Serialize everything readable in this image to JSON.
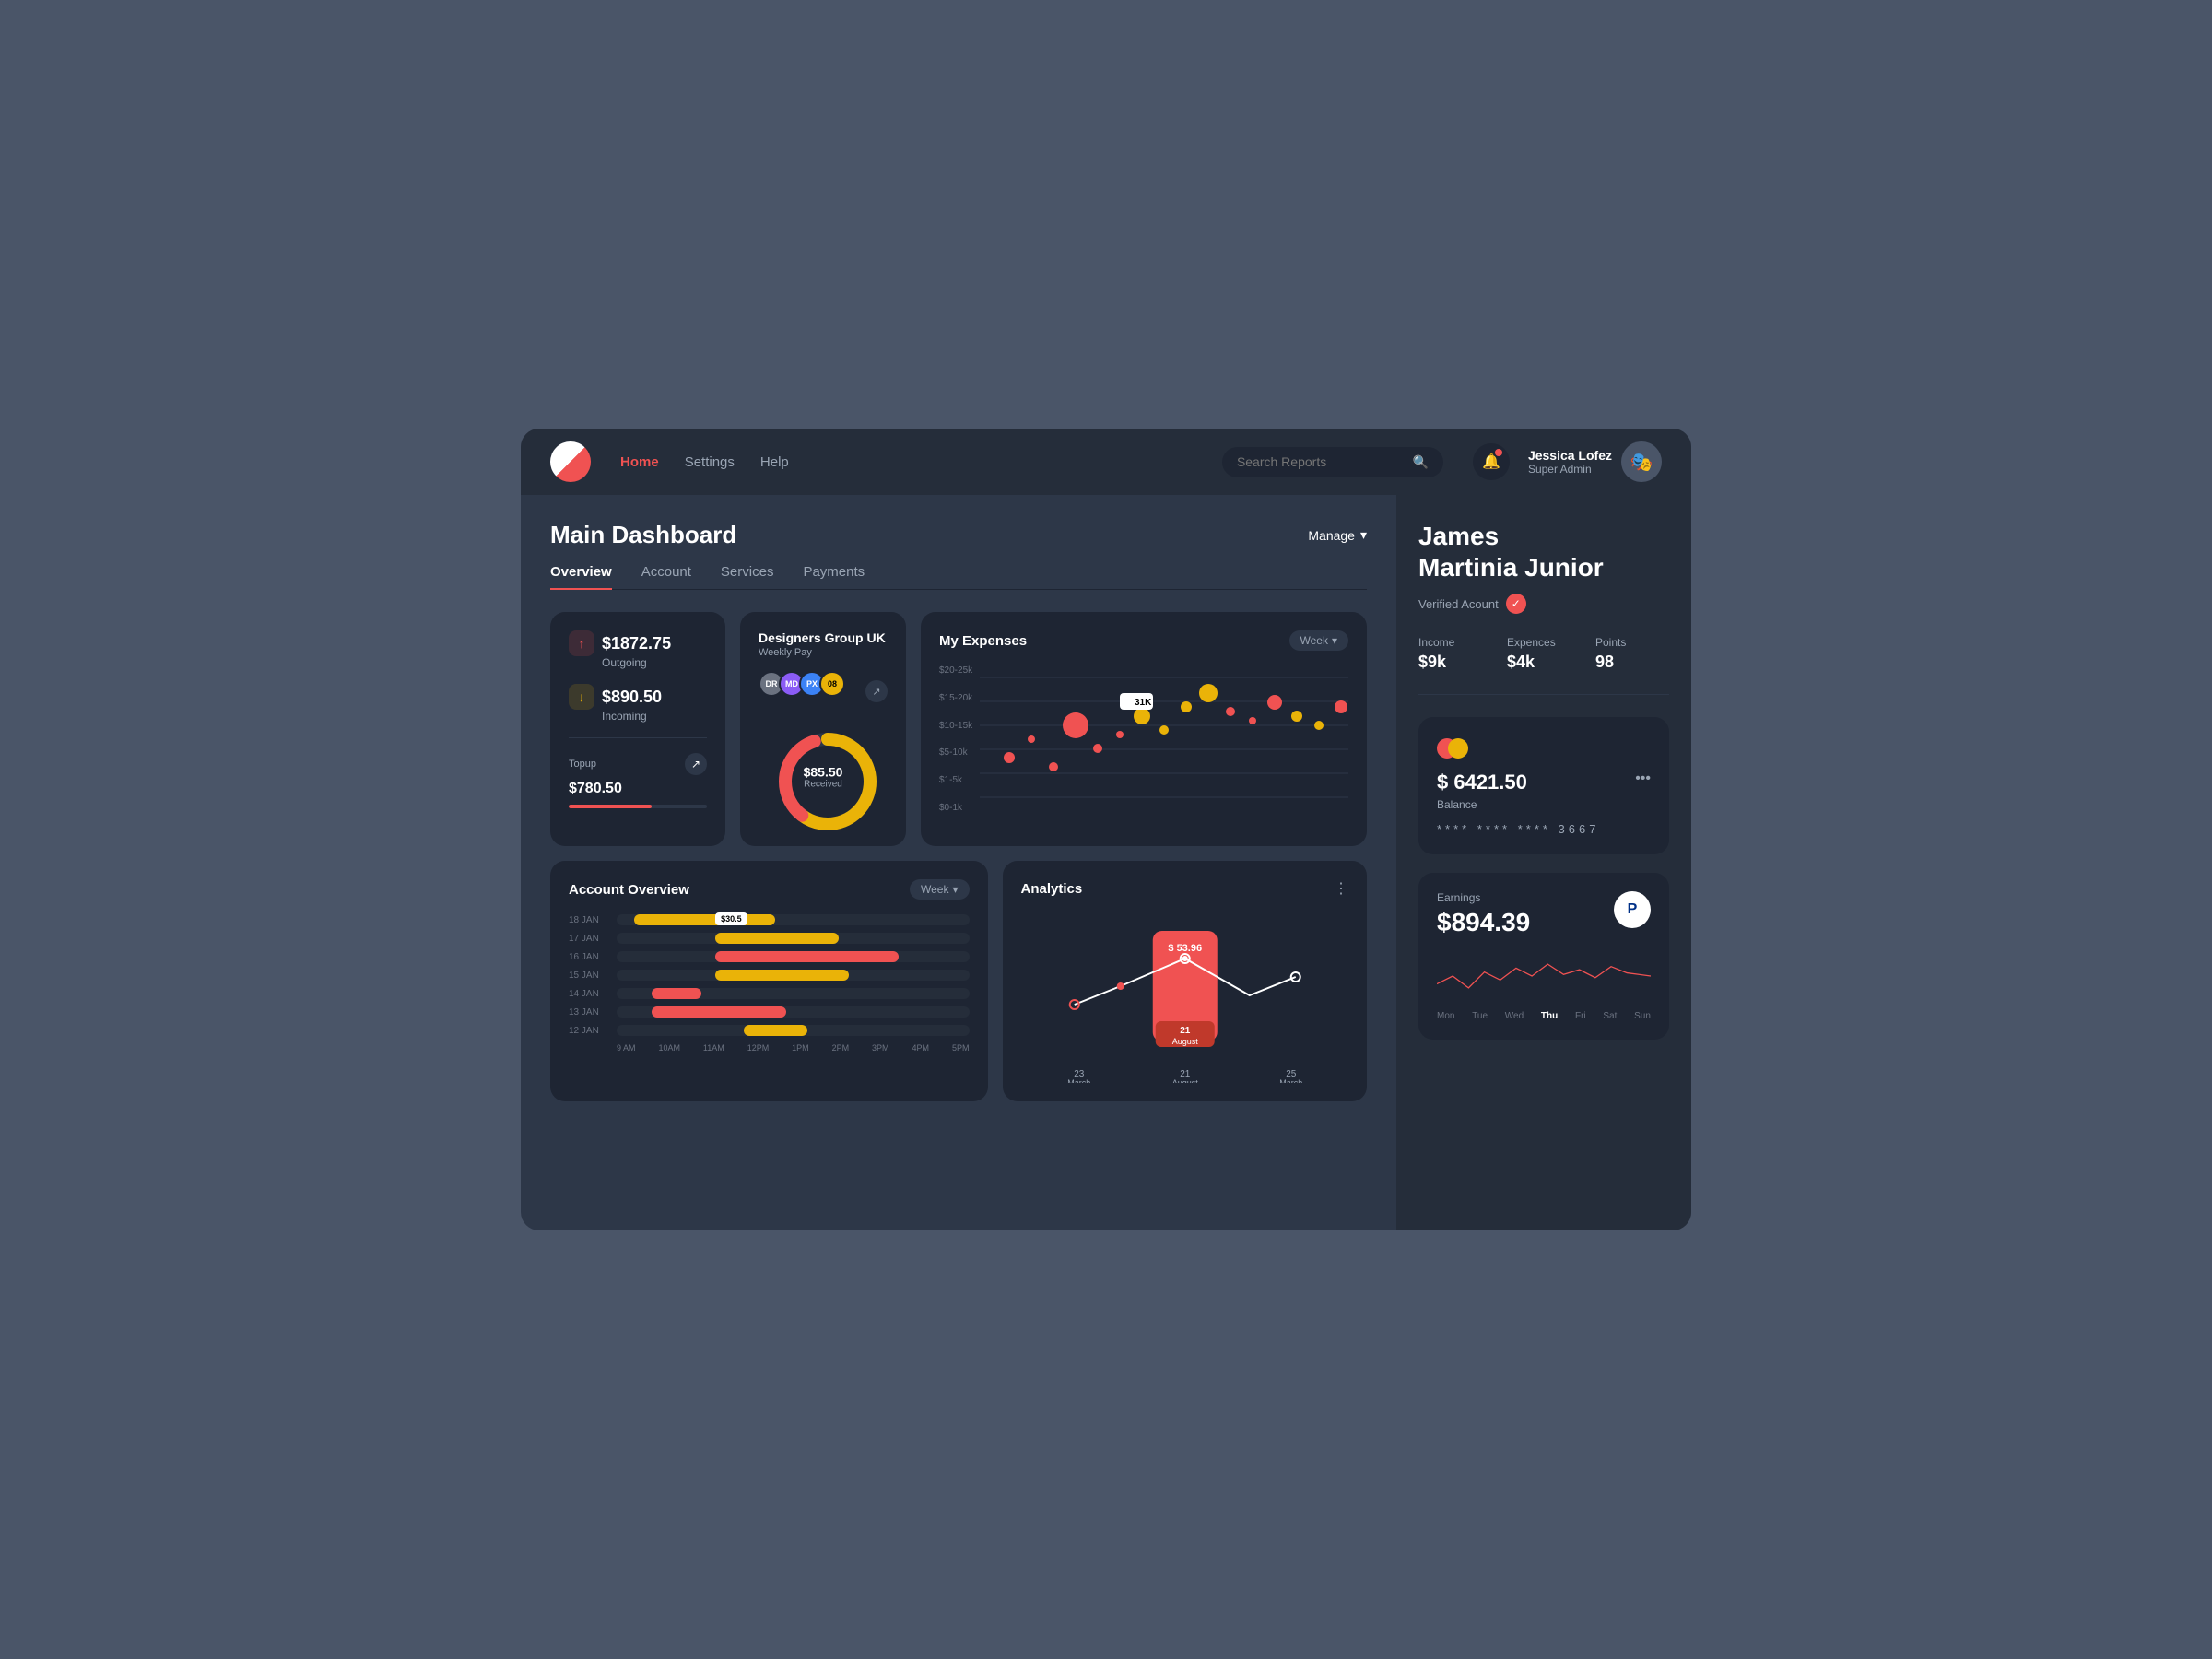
{
  "app": {
    "bg": "#4a5568"
  },
  "navbar": {
    "logo_alt": "Logo",
    "links": [
      {
        "label": "Home",
        "active": true
      },
      {
        "label": "Settings",
        "active": false
      },
      {
        "label": "Help",
        "active": false
      }
    ],
    "search_placeholder": "Search Reports",
    "bell_label": "Notifications",
    "user": {
      "name": "Jessica Lofez",
      "role": "Super Admin",
      "avatar": "👤"
    }
  },
  "dashboard": {
    "title": "Main Dashboard",
    "manage_label": "Manage",
    "tabs": [
      {
        "label": "Overview",
        "active": true
      },
      {
        "label": "Account",
        "active": false
      },
      {
        "label": "Services",
        "active": false
      },
      {
        "label": "Payments",
        "active": false
      }
    ]
  },
  "balance_card": {
    "outgoing_amount": "$1872.75",
    "outgoing_label": "Outgoing",
    "incoming_amount": "$890.50",
    "incoming_label": "Incoming",
    "topup_label": "Topup",
    "topup_amount": "$780.50",
    "progress_pct": 60
  },
  "designers_card": {
    "title": "Designers Group UK",
    "subtitle": "Weekly Pay",
    "avatars": [
      "DR",
      "MD",
      "PX",
      "08"
    ],
    "donut_amount": "$85.50",
    "donut_label": "Received"
  },
  "expenses_card": {
    "title": "My Expenses",
    "week_label": "Week",
    "y_labels": [
      "$20-25k",
      "$15-20k",
      "$10-15k",
      "$5-10k",
      "$1-5k",
      "$0-1k"
    ],
    "tooltip_value": "31K"
  },
  "overview_card": {
    "title": "Account Overview",
    "week_label": "Week",
    "rows": [
      {
        "label": "18 JAN",
        "bar_color": "yellow",
        "offset_pct": 5,
        "width_pct": 40
      },
      {
        "label": "17 JAN",
        "bar_color": "yellow",
        "offset_pct": 30,
        "width_pct": 35,
        "tooltip": "$30.5"
      },
      {
        "label": "16 JAN",
        "bar_color": "red",
        "offset_pct": 30,
        "width_pct": 50
      },
      {
        "label": "15 JAN",
        "bar_color": "yellow",
        "offset_pct": 30,
        "width_pct": 38
      },
      {
        "label": "14 JAN",
        "bar_color": "red",
        "offset_pct": 12,
        "width_pct": 14
      },
      {
        "label": "13 JAN",
        "bar_color": "red",
        "offset_pct": 12,
        "width_pct": 38
      },
      {
        "label": "12 JAN",
        "bar_color": "yellow",
        "offset_pct": 38,
        "width_pct": 18
      }
    ],
    "x_labels": [
      "9 AM",
      "10AM",
      "11AM",
      "12PM",
      "1PM",
      "2PM",
      "3PM",
      "4PM",
      "5PM"
    ]
  },
  "analytics_card": {
    "title": "Analytics",
    "bar_value": "$ 53.96",
    "bar_date_line1": "21",
    "bar_date_line2": "August",
    "dates": [
      {
        "label": "23",
        "sublabel": "March"
      },
      {
        "label": "21",
        "sublabel": "August",
        "active": true
      },
      {
        "label": "25",
        "sublabel": "March"
      }
    ]
  },
  "right_panel": {
    "profile_name": "James\nMartinia Junior",
    "verified_label": "Verified Acount",
    "income_label": "Income",
    "income_value": "$9k",
    "expenses_label": "Expences",
    "expenses_value": "$4k",
    "points_label": "Points",
    "points_value": "98",
    "card_balance": "$ 6421.50",
    "card_more_label": "•••",
    "balance_label": "Balance",
    "card_number": "****  ****  ****  3667",
    "earnings_label": "Earnings",
    "earnings_amount": "$894.39",
    "paypal_icon_text": "P",
    "days": [
      {
        "label": "Mon",
        "active": false
      },
      {
        "label": "Tue",
        "active": false
      },
      {
        "label": "Wed",
        "active": false
      },
      {
        "label": "Thu",
        "active": true
      },
      {
        "label": "Fri",
        "active": false
      },
      {
        "label": "Sat",
        "active": false
      },
      {
        "label": "Sun",
        "active": false
      }
    ]
  }
}
